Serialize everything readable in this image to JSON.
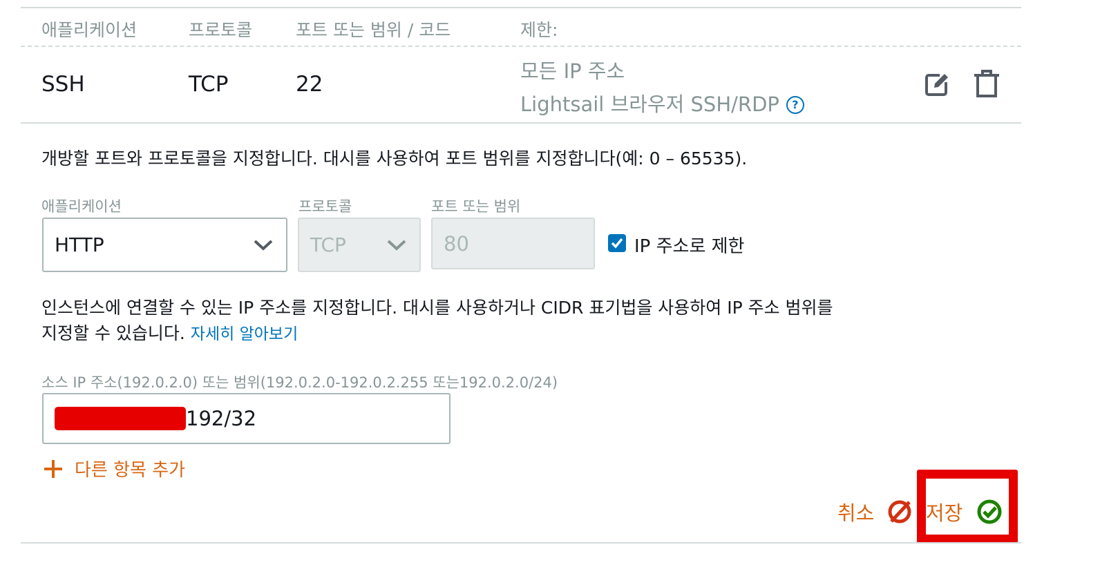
{
  "table": {
    "headers": [
      "애플리케이션",
      "프로토콜",
      "포트 또는 범위 / 코드",
      "제한:"
    ],
    "row": {
      "application": "SSH",
      "protocol": "TCP",
      "port": "22",
      "restriction_line1": "모든 IP 주소",
      "restriction_line2": "Lightsail 브라우저 SSH/RDP",
      "help_symbol": "?"
    },
    "row_icons": [
      "edit-icon",
      "trash-icon"
    ]
  },
  "form": {
    "intro": "개방할 포트와 프로토콜을 지정합니다. 대시를 사용하여 포트 범위를 지정합니다(예: 0 – 65535).",
    "application_label": "애플리케이션",
    "application_value": "HTTP",
    "protocol_label": "프로토콜",
    "protocol_value": "TCP",
    "port_label": "포트 또는 범위",
    "port_value": "80",
    "restrict_checkbox_label": "IP 주소로 제한",
    "restrict_checked": true,
    "ip_help_line1": "인스턴스에 연결할 수 있는 IP 주소를 지정합니다. 대시를 사용하거나 CIDR 표기법을 사용하여 IP 주소 범위를",
    "ip_help_line2": "지정할 수 있습니다.",
    "learn_more": "자세히 알아보기",
    "source_ip_label": "소스 IP 주소(192.0.2.0) 또는 범위(192.0.2.0-192.0.2.255 또는192.0.2.0/24)",
    "source_ip_value_visible": "192/32",
    "add_item": "다른 항목 추가"
  },
  "actions": {
    "cancel": "취소",
    "save": "저장"
  },
  "colors": {
    "accent_orange": "#d86613",
    "link_blue": "#0073bb",
    "save_green": "#1d8102",
    "cancel_red": "#d13212",
    "highlight_red": "#e60000",
    "redaction_red": "#e60000"
  }
}
